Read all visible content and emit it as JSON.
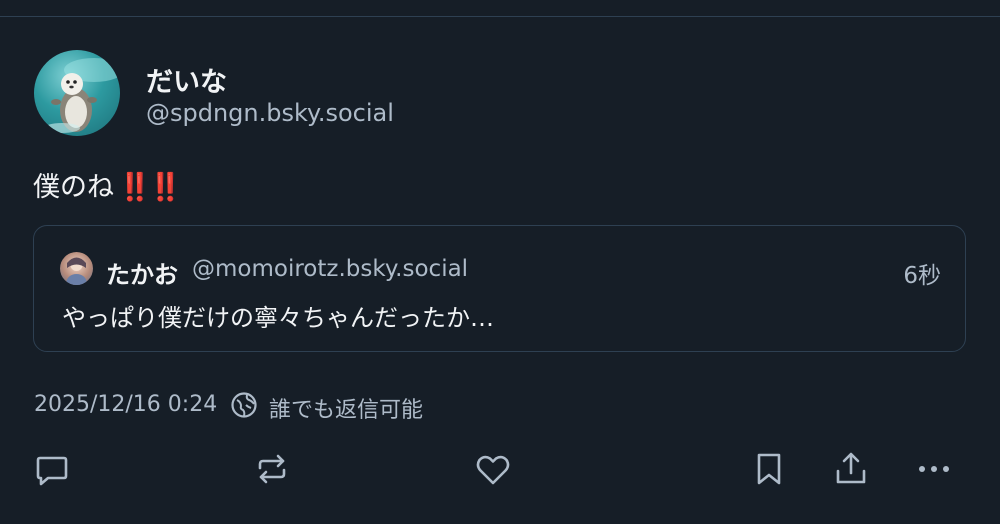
{
  "post": {
    "author": {
      "display_name": "だいな",
      "handle": "@spdngn.bsky.social",
      "avatar_icon": "sea-otter-avatar"
    },
    "text": "僕のね",
    "emoji": "‼️‼️",
    "quote": {
      "author_name": "たかお",
      "author_handle": "@momoirotz.bsky.social",
      "time_ago": "6秒",
      "text": "やっぱり僕だけの寧々ちゃんだったか…"
    },
    "timestamp": "2025/12/16 0:24",
    "reply_setting": "誰でも返信可能"
  },
  "actions": [
    {
      "name": "reply-button",
      "icon": "reply-icon"
    },
    {
      "name": "repost-button",
      "icon": "repost-icon"
    },
    {
      "name": "like-button",
      "icon": "heart-icon"
    },
    {
      "name": "bookmark-button",
      "icon": "bookmark-icon"
    },
    {
      "name": "share-button",
      "icon": "share-icon"
    },
    {
      "name": "more-button",
      "icon": "more-icon"
    }
  ],
  "colors": {
    "background": "#161e27",
    "text_primary": "#f1f3f5",
    "text_secondary": "#aebbc9",
    "border": "#2e4052",
    "emoji_red": "#e0245e"
  }
}
